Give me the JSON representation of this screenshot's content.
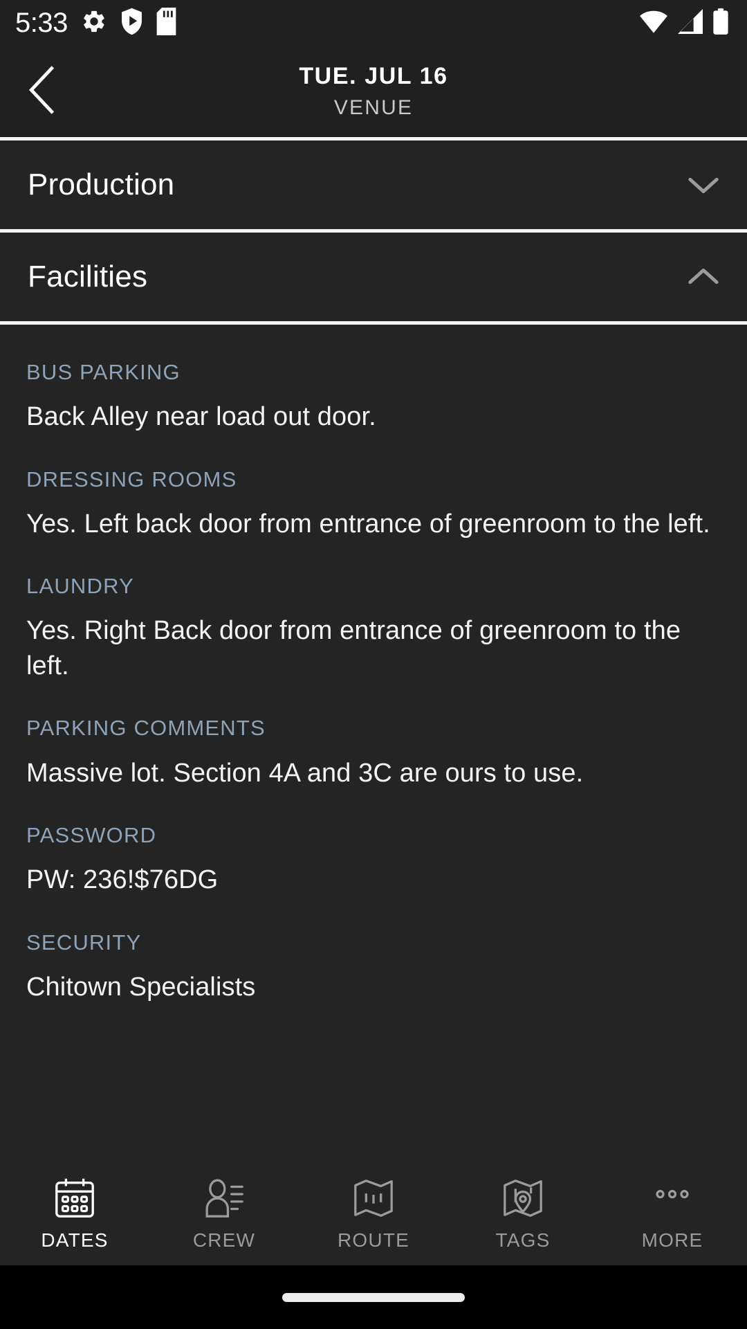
{
  "status_bar": {
    "time": "5:33",
    "left_icons": [
      "gear-icon",
      "play-protect-shield-icon",
      "sd-card-icon"
    ],
    "right_icons": [
      "wifi-icon",
      "cell-signal-icon",
      "battery-icon"
    ]
  },
  "header": {
    "back_icon": "chevron-left-icon",
    "title": "TUE. JUL 16",
    "subtitle": "VENUE"
  },
  "sections": [
    {
      "label": "Production",
      "expanded": false,
      "chevron": "chevron-down-icon"
    },
    {
      "label": "Facilities",
      "expanded": true,
      "chevron": "chevron-up-icon"
    }
  ],
  "facilities_fields": [
    {
      "label": "BUS PARKING",
      "value": "Back Alley near load out door."
    },
    {
      "label": "DRESSING ROOMS",
      "value": "Yes. Left back door from entrance of greenroom to the left."
    },
    {
      "label": "LAUNDRY",
      "value": "Yes. Right Back door from entrance of greenroom to the left."
    },
    {
      "label": "PARKING COMMENTS",
      "value": "Massive lot. Section 4A and 3C are ours to use."
    },
    {
      "label": "PASSWORD",
      "value": "PW: 236!$76DG"
    },
    {
      "label": "SECURITY",
      "value": "Chitown Specialists"
    }
  ],
  "tabs": [
    {
      "label": "DATES",
      "icon": "calendar-icon",
      "active": true
    },
    {
      "label": "CREW",
      "icon": "person-list-icon",
      "active": false
    },
    {
      "label": "ROUTE",
      "icon": "folded-map-icon",
      "active": false
    },
    {
      "label": "TAGS",
      "icon": "map-pin-icon",
      "active": false
    },
    {
      "label": "MORE",
      "icon": "three-dots-icon",
      "active": false
    }
  ],
  "colors": {
    "background": "#242424",
    "header_background": "#202020",
    "divider": "#f2f2f2",
    "field_label": "#8ea2b8",
    "field_value": "#f4f4f4",
    "tab_active": "#ffffff",
    "tab_inactive": "#9a9a9a"
  }
}
